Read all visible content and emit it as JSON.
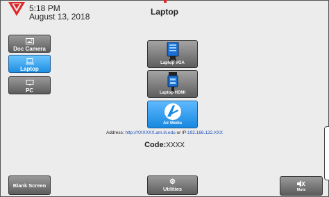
{
  "header": {
    "time": "5:18 PM",
    "date": "August 13, 2018",
    "room_title": "Laptop"
  },
  "sources": [
    {
      "label": "Doc Camera",
      "icon": "document-camera-icon",
      "active": false
    },
    {
      "label": "Laptop",
      "icon": "laptop-icon",
      "active": true
    },
    {
      "label": "PC",
      "icon": "monitor-icon",
      "active": false
    }
  ],
  "inputs": [
    {
      "label": "Laptop VGA",
      "icon": "vga-cable-icon",
      "active": false
    },
    {
      "label": "Laptop HDMI",
      "icon": "hdmi-cable-icon",
      "active": false
    },
    {
      "label": "Air Media",
      "icon": "air-media-icon",
      "active": true
    }
  ],
  "airmedia": {
    "address_prefix": "Address: ",
    "address_url": "http://XXXXXX.am.iit.edu",
    "address_mid": " or IP:",
    "address_ip": "192.168.122.XXX",
    "code_label": "Code:",
    "code_value": "XXXX"
  },
  "footer": {
    "blank_label": "Blank Screen",
    "utilities_label": "Utilities",
    "mute_label": "Mute"
  },
  "colors": {
    "active_blue": "#1e8fe0",
    "button_gray": "#6e6e6e",
    "brand_red": "#e0282a",
    "link_blue": "#1d4fb8"
  }
}
